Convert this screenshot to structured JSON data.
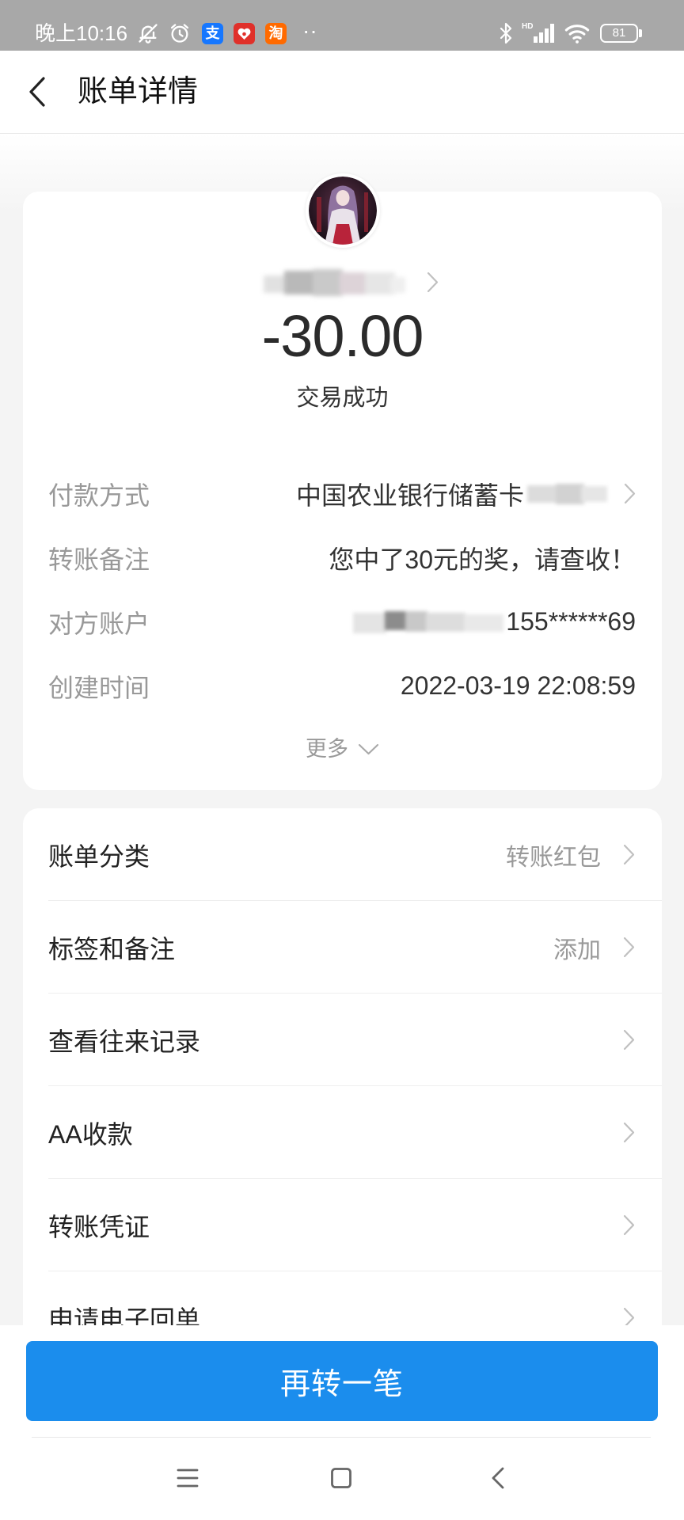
{
  "status_bar": {
    "time": "晚上10:16",
    "icons": [
      "bell-off-icon",
      "alarm-icon",
      "alipay-app-icon",
      "red-app-icon",
      "taobao-app-icon",
      "bluetooth-icon",
      "signal-icon",
      "wifi-icon",
      "battery-icon"
    ],
    "alipay_logo_text": "支",
    "taobao_logo_text": "淘",
    "more_indicator": "··",
    "network_label": "HD",
    "battery_level": "81"
  },
  "header": {
    "back_icon": "chevron-left-icon",
    "title": "账单详情"
  },
  "summary": {
    "amount": "-30.00",
    "status": "交易成功"
  },
  "details": [
    {
      "label": "付款方式",
      "value": "中国农业银行储蓄卡"
    },
    {
      "label": "转账备注",
      "value": "您中了30元的奖，请查收！"
    },
    {
      "label": "对方账户",
      "value": "155******69"
    },
    {
      "label": "创建时间",
      "value": "2022-03-19 22:08:59"
    }
  ],
  "more": {
    "label": "更多",
    "icon": "chevron-down-icon"
  },
  "menu": [
    {
      "label": "账单分类",
      "value": "转账红包"
    },
    {
      "label": "标签和备注",
      "value": "添加"
    },
    {
      "label": "查看往来记录"
    },
    {
      "label": "AA收款"
    },
    {
      "label": "转账凭证"
    },
    {
      "label": "申请电子回单"
    }
  ],
  "primary_button": {
    "label": "再转一笔"
  },
  "nav_bar": {
    "icons": [
      "menu-icon",
      "home-icon",
      "back-icon"
    ]
  },
  "colors": {
    "status_bar_bg": "#a8a8a8",
    "page_bg": "#f5f5f5",
    "accent_blue": "#1b8ded",
    "label_gray": "#999999",
    "text_dark": "#333333"
  }
}
